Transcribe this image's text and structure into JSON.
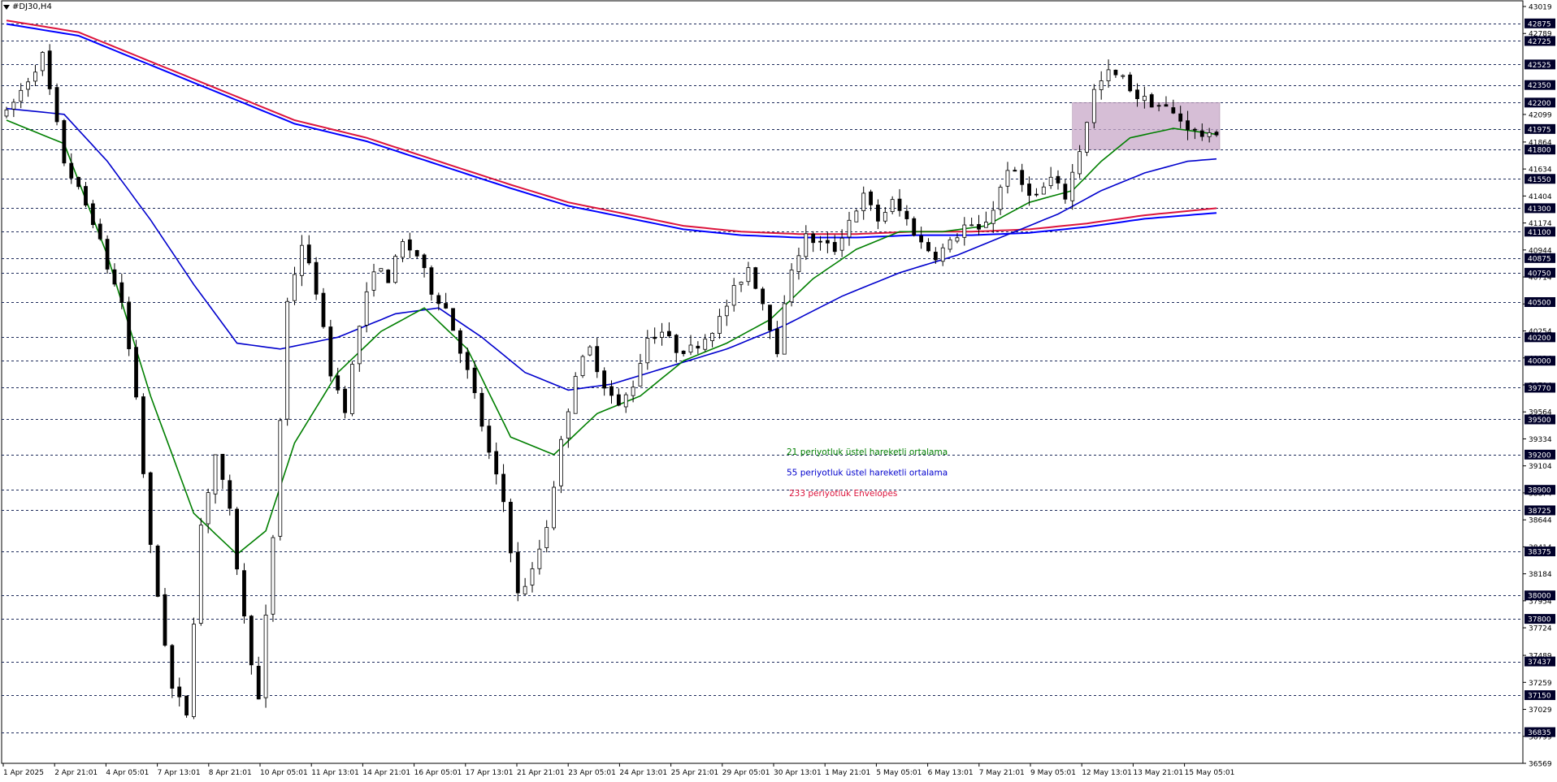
{
  "window": {
    "symbol": "#DJ30,H4"
  },
  "colors": {
    "up": "#ffffff",
    "down": "#000000",
    "outline": "#000000",
    "ema21": "#007f00",
    "ema55": "#0000cd",
    "env_upper": "#dc143c",
    "env_lower": "#0000ff",
    "box": "#c8a8c8",
    "label_bg": "#00002a",
    "grid": "#1c2a5a"
  },
  "legend": [
    {
      "text": "21 periyotluk üstel hareketli ortalama",
      "color": "#007f00"
    },
    {
      "text": "55 periyotluk üstel hareketli ortalama",
      "color": "#0000cd"
    },
    {
      "text": "233 periyotluk Envelopes",
      "color": "#dc143c"
    }
  ],
  "chart_data": {
    "type": "candlestick",
    "title": "#DJ30,H4",
    "ylim": [
      36569,
      43019
    ],
    "y_ticks": [
      43019,
      42789,
      42099,
      41864,
      41634,
      41404,
      41174,
      40944,
      40714,
      40484,
      40254,
      40024,
      39794,
      39564,
      39334,
      39104,
      38874,
      38644,
      38414,
      38184,
      37954,
      37724,
      37489,
      37259,
      37029,
      36799,
      36569
    ],
    "level_lines": [
      42875,
      42725,
      42525,
      42350,
      42200,
      41975,
      41800,
      41550,
      41300,
      41100,
      40875,
      40750,
      40500,
      40200,
      40000,
      39770,
      39500,
      39200,
      38900,
      38725,
      38375,
      38000,
      37800,
      37437,
      37150,
      36835
    ],
    "x_labels": [
      "1 Apr 2025",
      "2 Apr 21:01",
      "4 Apr 05:01",
      "7 Apr 13:01",
      "8 Apr 21:01",
      "10 Apr 05:01",
      "11 Apr 13:01",
      "14 Apr 21:01",
      "16 Apr 05:01",
      "17 Apr 13:01",
      "21 Apr 21:01",
      "23 Apr 05:01",
      "24 Apr 13:01",
      "25 Apr 21:01",
      "29 Apr 05:01",
      "30 Apr 13:01",
      "1 May 21:01",
      "5 May 05:01",
      "6 May 13:01",
      "7 May 21:01",
      "9 May 05:01",
      "12 May 13:01",
      "13 May 21:01",
      "15 May 05:01"
    ],
    "zone": {
      "x_from": "9 May 05:01",
      "x_to": "15 May 05:01",
      "y_low": 41800,
      "y_high": 42200
    },
    "price_path": [
      [
        0,
        42100
      ],
      [
        5,
        42600
      ],
      [
        8,
        41700
      ],
      [
        12,
        41200
      ],
      [
        14,
        40800
      ],
      [
        16,
        40500
      ],
      [
        18,
        39700
      ],
      [
        20,
        38400
      ],
      [
        23,
        37200
      ],
      [
        25,
        37000
      ],
      [
        27,
        38600
      ],
      [
        29,
        39200
      ],
      [
        31,
        38700
      ],
      [
        33,
        37800
      ],
      [
        35,
        37100
      ],
      [
        37,
        38500
      ],
      [
        39,
        40500
      ],
      [
        41,
        41000
      ],
      [
        43,
        40600
      ],
      [
        45,
        39900
      ],
      [
        47,
        39600
      ],
      [
        49,
        40300
      ],
      [
        51,
        40800
      ],
      [
        53,
        40700
      ],
      [
        55,
        41000
      ],
      [
        57,
        40900
      ],
      [
        59,
        40600
      ],
      [
        61,
        40450
      ],
      [
        63,
        40100
      ],
      [
        65,
        39700
      ],
      [
        67,
        39200
      ],
      [
        69,
        38800
      ],
      [
        71,
        38000
      ],
      [
        73,
        38200
      ],
      [
        75,
        38600
      ],
      [
        77,
        39300
      ],
      [
        79,
        39900
      ],
      [
        81,
        40100
      ],
      [
        83,
        39800
      ],
      [
        85,
        39600
      ],
      [
        87,
        39800
      ],
      [
        89,
        40200
      ],
      [
        91,
        40250
      ],
      [
        93,
        40100
      ],
      [
        95,
        40100
      ],
      [
        97,
        40200
      ],
      [
        99,
        40350
      ],
      [
        101,
        40600
      ],
      [
        103,
        40800
      ],
      [
        105,
        40500
      ],
      [
        107,
        40100
      ],
      [
        109,
        40800
      ],
      [
        111,
        41050
      ],
      [
        113,
        41000
      ],
      [
        115,
        40950
      ],
      [
        117,
        41200
      ],
      [
        119,
        41400
      ],
      [
        121,
        41200
      ],
      [
        123,
        41350
      ],
      [
        125,
        41200
      ],
      [
        127,
        41000
      ],
      [
        129,
        40900
      ],
      [
        131,
        41000
      ],
      [
        133,
        41150
      ],
      [
        135,
        41100
      ],
      [
        137,
        41300
      ],
      [
        139,
        41650
      ],
      [
        141,
        41500
      ],
      [
        143,
        41400
      ],
      [
        145,
        41550
      ],
      [
        147,
        41400
      ],
      [
        149,
        41800
      ],
      [
        151,
        42300
      ],
      [
        153,
        42450
      ],
      [
        155,
        42400
      ],
      [
        157,
        42250
      ],
      [
        159,
        42200
      ],
      [
        161,
        42150
      ],
      [
        163,
        42050
      ],
      [
        165,
        41950
      ],
      [
        167,
        41900
      ],
      [
        168,
        41960
      ]
    ],
    "series": [
      {
        "name": "21 periyotluk üstel hareketli ortalama",
        "type": "line",
        "points": [
          [
            0,
            42050
          ],
          [
            8,
            41850
          ],
          [
            14,
            40900
          ],
          [
            20,
            39700
          ],
          [
            26,
            38700
          ],
          [
            32,
            38350
          ],
          [
            36,
            38550
          ],
          [
            40,
            39300
          ],
          [
            46,
            39900
          ],
          [
            52,
            40250
          ],
          [
            58,
            40450
          ],
          [
            64,
            40100
          ],
          [
            70,
            39350
          ],
          [
            76,
            39200
          ],
          [
            82,
            39550
          ],
          [
            88,
            39700
          ],
          [
            94,
            40000
          ],
          [
            100,
            40150
          ],
          [
            106,
            40350
          ],
          [
            112,
            40700
          ],
          [
            118,
            40950
          ],
          [
            124,
            41100
          ],
          [
            130,
            41100
          ],
          [
            136,
            41150
          ],
          [
            142,
            41350
          ],
          [
            148,
            41450
          ],
          [
            152,
            41700
          ],
          [
            156,
            41900
          ],
          [
            162,
            41980
          ],
          [
            168,
            41930
          ]
        ]
      },
      {
        "name": "55 periyotluk üstel hareketli ortalama",
        "type": "line",
        "points": [
          [
            0,
            42150
          ],
          [
            8,
            42100
          ],
          [
            14,
            41700
          ],
          [
            20,
            41200
          ],
          [
            26,
            40650
          ],
          [
            32,
            40150
          ],
          [
            38,
            40100
          ],
          [
            46,
            40200
          ],
          [
            54,
            40400
          ],
          [
            60,
            40450
          ],
          [
            66,
            40200
          ],
          [
            72,
            39900
          ],
          [
            78,
            39750
          ],
          [
            84,
            39800
          ],
          [
            92,
            39950
          ],
          [
            100,
            40100
          ],
          [
            108,
            40300
          ],
          [
            116,
            40550
          ],
          [
            124,
            40750
          ],
          [
            132,
            40900
          ],
          [
            140,
            41100
          ],
          [
            146,
            41250
          ],
          [
            152,
            41450
          ],
          [
            158,
            41600
          ],
          [
            164,
            41700
          ],
          [
            168,
            41720
          ]
        ]
      },
      {
        "name": "233 periyotluk Envelopes",
        "type": "band",
        "upper": [
          [
            0,
            42900
          ],
          [
            10,
            42800
          ],
          [
            20,
            42550
          ],
          [
            30,
            42300
          ],
          [
            40,
            42050
          ],
          [
            50,
            41900
          ],
          [
            60,
            41700
          ],
          [
            70,
            41500
          ],
          [
            78,
            41350
          ],
          [
            86,
            41250
          ],
          [
            94,
            41150
          ],
          [
            102,
            41100
          ],
          [
            110,
            41080
          ],
          [
            118,
            41080
          ],
          [
            126,
            41100
          ],
          [
            134,
            41100
          ],
          [
            142,
            41120
          ],
          [
            150,
            41170
          ],
          [
            158,
            41240
          ],
          [
            168,
            41300
          ]
        ],
        "lower": [
          [
            0,
            42870
          ],
          [
            10,
            42770
          ],
          [
            20,
            42520
          ],
          [
            30,
            42270
          ],
          [
            40,
            42020
          ],
          [
            50,
            41870
          ],
          [
            60,
            41670
          ],
          [
            70,
            41470
          ],
          [
            78,
            41320
          ],
          [
            86,
            41220
          ],
          [
            94,
            41120
          ],
          [
            102,
            41070
          ],
          [
            110,
            41050
          ],
          [
            118,
            41050
          ],
          [
            126,
            41070
          ],
          [
            134,
            41070
          ],
          [
            142,
            41090
          ],
          [
            150,
            41140
          ],
          [
            158,
            41210
          ],
          [
            168,
            41260
          ]
        ]
      }
    ]
  }
}
